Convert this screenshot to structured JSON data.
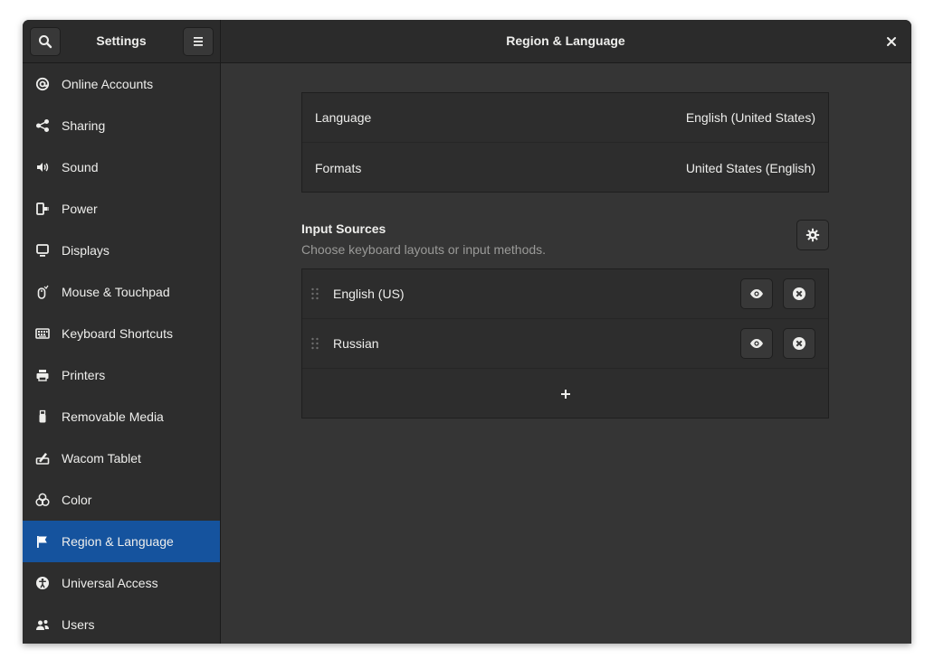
{
  "header": {
    "settings_title": "Settings",
    "main_title": "Region & Language"
  },
  "sidebar": {
    "items": [
      {
        "label": "Online Accounts",
        "icon": "at-icon"
      },
      {
        "label": "Sharing",
        "icon": "share-icon"
      },
      {
        "label": "Sound",
        "icon": "speaker-icon"
      },
      {
        "label": "Power",
        "icon": "power-plug-icon"
      },
      {
        "label": "Displays",
        "icon": "display-icon"
      },
      {
        "label": "Mouse & Touchpad",
        "icon": "mouse-icon"
      },
      {
        "label": "Keyboard Shortcuts",
        "icon": "keyboard-icon"
      },
      {
        "label": "Printers",
        "icon": "printer-icon"
      },
      {
        "label": "Removable Media",
        "icon": "usb-icon"
      },
      {
        "label": "Wacom Tablet",
        "icon": "tablet-icon"
      },
      {
        "label": "Color",
        "icon": "color-circles-icon"
      },
      {
        "label": "Region & Language",
        "icon": "flag-icon",
        "active": true
      },
      {
        "label": "Universal Access",
        "icon": "accessibility-icon"
      },
      {
        "label": "Users",
        "icon": "users-icon"
      }
    ]
  },
  "region": {
    "language_label": "Language",
    "language_value": "English (United States)",
    "formats_label": "Formats",
    "formats_value": "United States (English)"
  },
  "input_sources": {
    "title": "Input Sources",
    "subtitle": "Choose keyboard layouts or input methods.",
    "sources": [
      {
        "label": "English (US)"
      },
      {
        "label": "Russian"
      }
    ]
  },
  "colors": {
    "accent": "#15539e",
    "window_bg": "#353535",
    "sidebar_bg": "#2d2d2d"
  }
}
